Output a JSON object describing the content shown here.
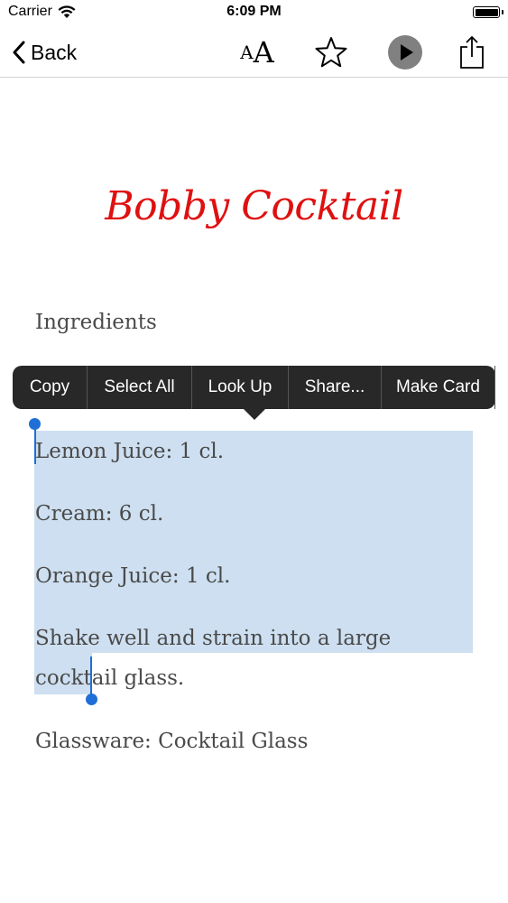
{
  "status_bar": {
    "carrier": "Carrier",
    "time": "6:09 PM",
    "battery_level": 1.0
  },
  "nav": {
    "back_label": "Back",
    "icons": [
      "chevron-left-icon",
      "font-size-icon",
      "star-icon",
      "play-icon",
      "share-icon"
    ],
    "font_small": "A",
    "font_big": "A"
  },
  "recipe": {
    "title": "Bobby Cocktail",
    "ingredients_heading": "Ingredients",
    "lines": [
      "Lemon Juice: 1 cl.",
      "Cream: 6 cl.",
      "Orange Juice: 1 cl.",
      "Shake well and strain into a large cocktail glass."
    ],
    "glassware": "Glassware: Cocktail Glass"
  },
  "edit_menu": {
    "items": [
      "Copy",
      "Select All",
      "Look Up",
      "Share...",
      "Make Card"
    ]
  },
  "colors": {
    "title": "#e01010",
    "body_text": "#4a4a4a",
    "selection": "#cddff0",
    "handle": "#1f6fd6",
    "menu_bg": "#282828"
  }
}
